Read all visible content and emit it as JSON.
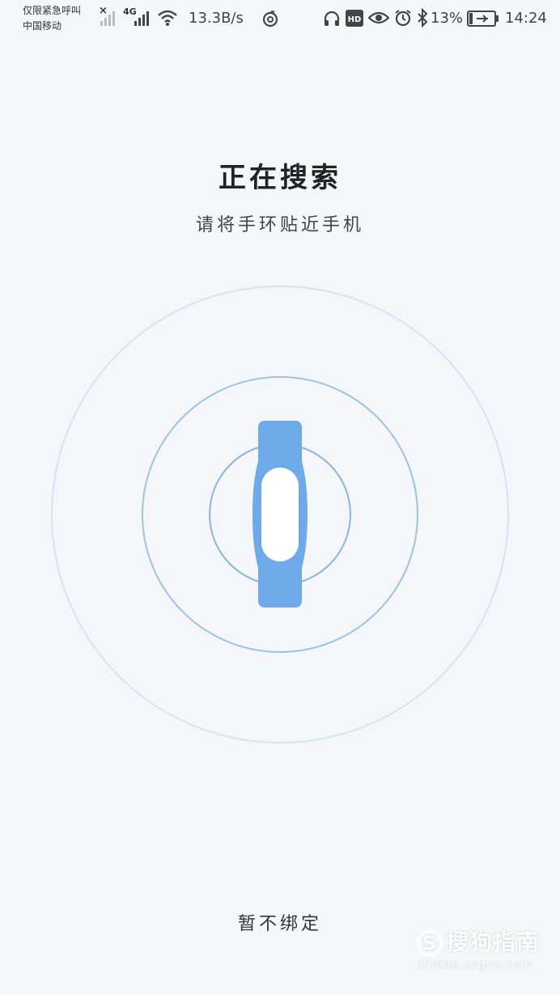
{
  "status_bar": {
    "carrier_line1": "仅限紧急呼叫",
    "carrier_line2": "中国移动",
    "network_type": "4G",
    "net_speed": "13.3B/s",
    "battery_percent": "13%",
    "time": "14:24",
    "icons": [
      "no-sim-icon",
      "signal-weak-icon",
      "signal-4g-icon",
      "wifi-icon",
      "netease-music-icon",
      "headphones-icon",
      "hd-icon",
      "eye-icon",
      "alarm-icon",
      "bluetooth-icon",
      "battery-charging-icon"
    ]
  },
  "main": {
    "title": "正在搜索",
    "subtitle": "请将手环贴近手机"
  },
  "footer": {
    "skip_label": "暂不绑定"
  },
  "watermark": {
    "brand": "搜狗指南",
    "url": "zhinan.sogou.com"
  },
  "colors": {
    "background": "#f4f6f9",
    "band": "#6ea9ea",
    "ring_outer": "#d4e4f3",
    "ring_middle": "#9cc3e6",
    "ring_inner": "#8bb6df"
  }
}
